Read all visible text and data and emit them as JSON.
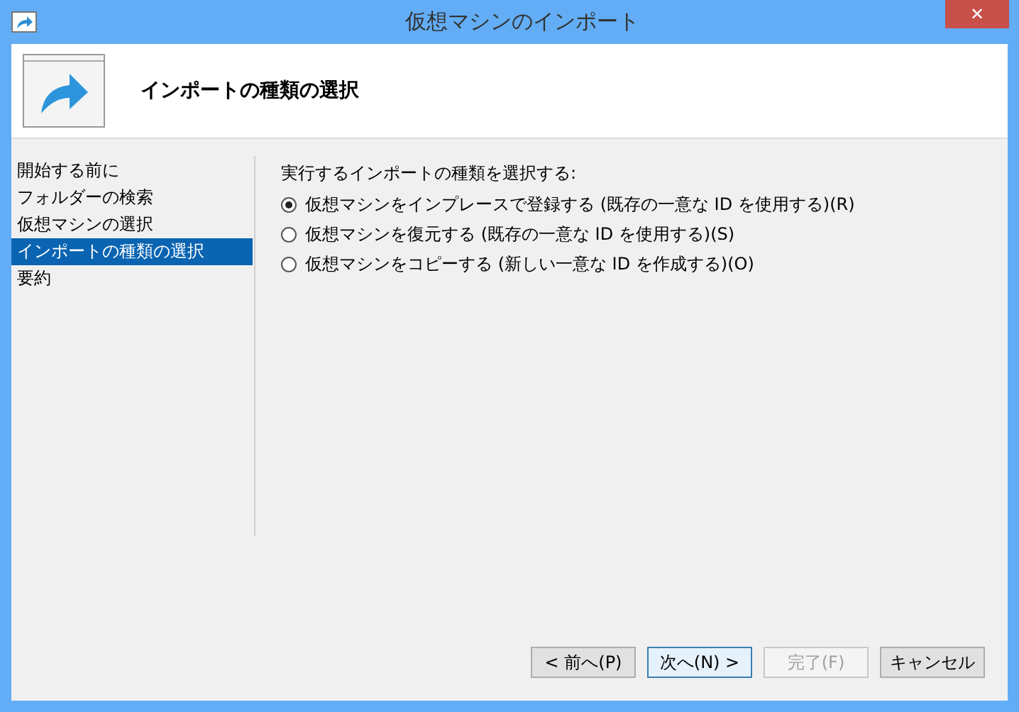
{
  "window": {
    "title": "仮想マシンのインポート",
    "close": "✕"
  },
  "header": {
    "title": "インポートの種類の選択"
  },
  "sidebar": {
    "items": [
      {
        "label": "開始する前に",
        "selected": false
      },
      {
        "label": "フォルダーの検索",
        "selected": false
      },
      {
        "label": "仮想マシンの選択",
        "selected": false
      },
      {
        "label": "インポートの種類の選択",
        "selected": true
      },
      {
        "label": "要約",
        "selected": false
      }
    ]
  },
  "content": {
    "prompt": "実行するインポートの種類を選択する:",
    "options": [
      {
        "label": "仮想マシンをインプレースで登録する (既存の一意な ID を使用する)(R)",
        "selected": true
      },
      {
        "label": "仮想マシンを復元する (既存の一意な ID を使用する)(S)",
        "selected": false
      },
      {
        "label": "仮想マシンをコピーする (新しい一意な ID を作成する)(O)",
        "selected": false
      }
    ]
  },
  "buttons": [
    {
      "label": "< 前へ(P)",
      "disabled": false,
      "focused": false
    },
    {
      "label": "次へ(N) >",
      "disabled": false,
      "focused": true
    },
    {
      "label": "完了(F)",
      "disabled": true,
      "focused": false
    },
    {
      "label": "キャンセル",
      "disabled": false,
      "focused": false
    }
  ]
}
